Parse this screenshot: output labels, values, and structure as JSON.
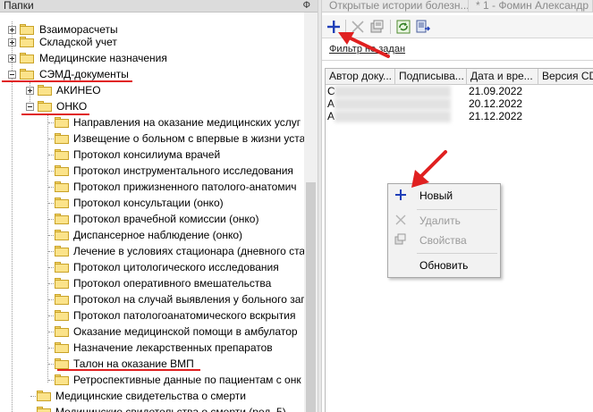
{
  "left_panel": {
    "title": "Папки",
    "pin_glyph": "Ф",
    "tree": [
      {
        "label": "Взаиморасчеты",
        "expander": "plus"
      },
      {
        "label": "Складской учет",
        "expander": "plus"
      },
      {
        "label": "Медицинские назначения",
        "expander": "plus"
      },
      {
        "label": "СЭМД-документы",
        "expander": "minus"
      },
      {
        "label": "АКИНЕО",
        "expander": "plus"
      },
      {
        "label": "ОНКО",
        "expander": "minus"
      },
      {
        "label": "Направления на оказание медицинских услуг"
      },
      {
        "label": "Извещение о больном с впервые в жизни уста"
      },
      {
        "label": "Протокол консилиума врачей"
      },
      {
        "label": "Протокол инструментального исследования"
      },
      {
        "label": "Протокол прижизненного патолого-анатомич"
      },
      {
        "label": "Протокол консультации (онко)"
      },
      {
        "label": "Протокол врачебной комиссии (онко)"
      },
      {
        "label": "Диспансерное наблюдение (онко)"
      },
      {
        "label": "Лечение в условиях стационара (дневного ста"
      },
      {
        "label": "Протокол цитологического исследования"
      },
      {
        "label": "Протокол оперативного вмешательства"
      },
      {
        "label": "Протокол на случай выявления у больного зап"
      },
      {
        "label": "Протокол патологоанатомического вскрытия"
      },
      {
        "label": "Оказание медицинской помощи в амбулатор"
      },
      {
        "label": "Назначение лекарственных препаратов"
      },
      {
        "label": "Талон на оказание ВМП"
      },
      {
        "label": "Ретроспективные данные по пациентам с онк"
      },
      {
        "label": "Медицинские свидетельства о смерти"
      },
      {
        "label": "Медицинские свидетельства о смерти (ред. 5)"
      }
    ]
  },
  "tabs": [
    {
      "label": "Открытые истории болезн..."
    },
    {
      "label": "* 1 - Фомин Александр"
    }
  ],
  "toolbar": {
    "add_icon": "plus-icon",
    "delete_icon": "delete-icon",
    "properties_icon": "properties-icon",
    "refresh_icon": "refresh-icon",
    "export_icon": "export-icon"
  },
  "filter": {
    "text": "Фильтр не задан"
  },
  "grid": {
    "columns": [
      "Автор доку...",
      "Подписыва...",
      "Дата и вре...",
      "Версия CD"
    ],
    "rows": [
      {
        "author": "С",
        "date": "21.09.2022"
      },
      {
        "author": "А",
        "date": "20.12.2022"
      },
      {
        "author": "А",
        "date": "21.12.2022"
      }
    ]
  },
  "context_menu": {
    "items": [
      {
        "label": "Новый",
        "icon": "plus-icon",
        "enabled": true
      },
      {
        "label": "Удалить",
        "icon": "delete-icon",
        "enabled": false
      },
      {
        "label": "Свойства",
        "icon": "properties-icon",
        "enabled": false
      },
      {
        "label": "Обновить",
        "icon": "",
        "enabled": true
      }
    ]
  },
  "colors": {
    "annotation_red": "#e02020",
    "add_blue": "#1f3fb8",
    "folder_yellow": "#fbe38a"
  }
}
